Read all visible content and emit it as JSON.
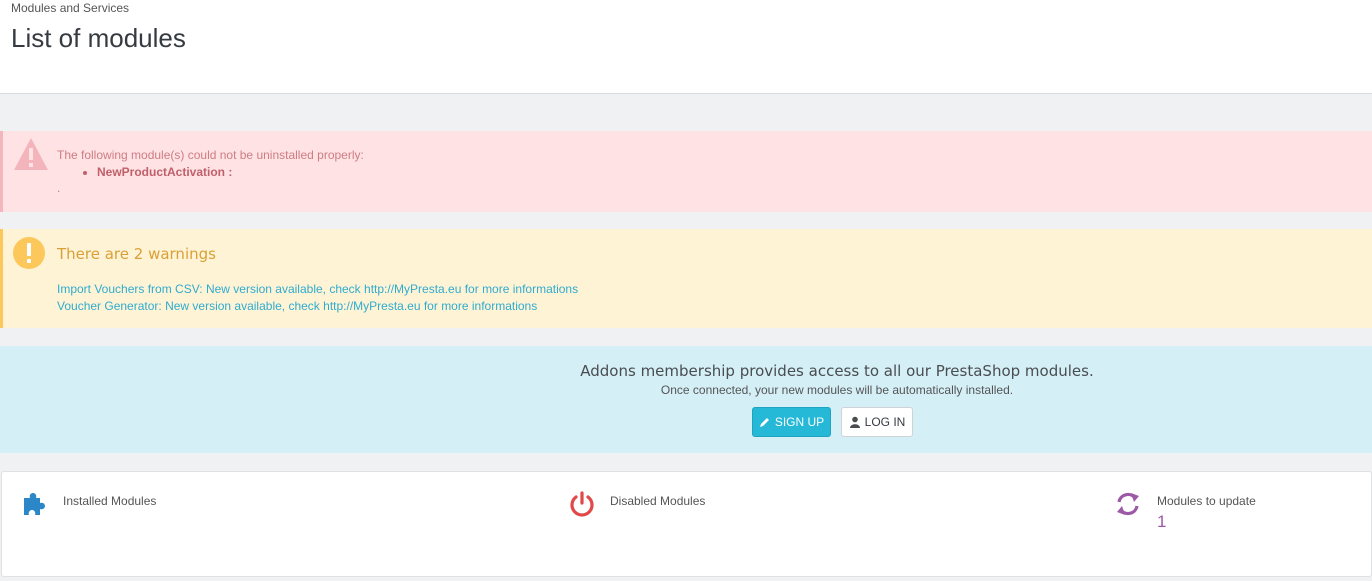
{
  "header": {
    "breadcrumb": "Modules and Services",
    "title": "List of modules"
  },
  "error_alert": {
    "message": "The following module(s) could not be uninstalled properly:",
    "modules": [
      "NewProductActivation :"
    ],
    "trailing": ".",
    "color": "#ffe2e4"
  },
  "warning_alert": {
    "title": "There are 2 warnings",
    "lines": [
      "Import Vouchers from CSV: New version available, check http://MyPresta.eu for more informations",
      "Voucher Generator: New version available, check http://MyPresta.eu for more informations"
    ],
    "color": "#fff3d6"
  },
  "addons": {
    "headline": "Addons membership provides access to all our PrestaShop modules.",
    "subline": "Once connected, your new modules will be automatically installed.",
    "signup_label": "SIGN UP",
    "login_label": "LOG IN",
    "accent": "#25b9d7"
  },
  "stats": {
    "installed": {
      "label": "Installed Modules",
      "icon": "puzzle-icon"
    },
    "disabled": {
      "label": "Disabled Modules",
      "icon": "power-icon"
    },
    "to_update": {
      "label": "Modules to update",
      "value": "1",
      "icon": "refresh-icon"
    }
  }
}
